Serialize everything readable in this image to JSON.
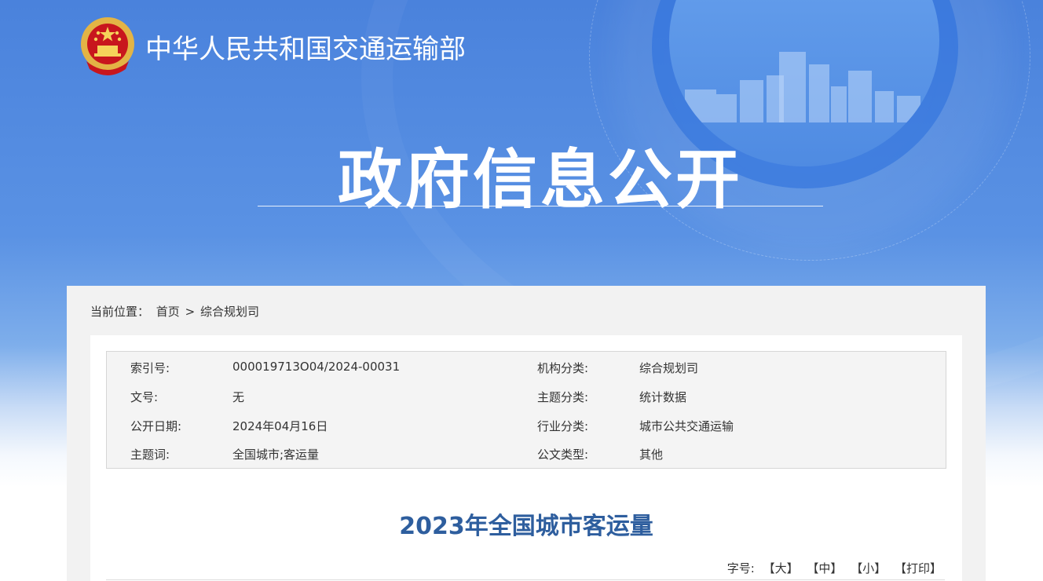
{
  "header": {
    "site_title": "中华人民共和国交通运输部",
    "hero_title": "政府信息公开"
  },
  "breadcrumb": {
    "label": "当前位置：",
    "home": "首页",
    "separator": ">",
    "current": "综合规划司"
  },
  "meta": {
    "index_label": "索引号:",
    "index_value": "000019713O04/2024-00031",
    "agency_label": "机构分类:",
    "agency_value": "综合规划司",
    "doc_no_label": "文号:",
    "doc_no_value": "无",
    "topic_label": "主题分类:",
    "topic_value": "统计数据",
    "date_label": "公开日期:",
    "date_value": "2024年04月16日",
    "industry_label": "行业分类:",
    "industry_value": "城市公共交通运输",
    "keywords_label": "主题词:",
    "keywords_value": "全国城市;客运量",
    "type_label": "公文类型:",
    "type_value": "其他"
  },
  "article": {
    "title": "2023年全国城市客运量"
  },
  "font_size": {
    "label": "字号:",
    "large": "【大】",
    "medium": "【中】",
    "small": "【小】",
    "print": "【打印】"
  },
  "colors": {
    "banner_blue": "#4a82dc",
    "title_blue": "#2e5e9e",
    "panel_gray": "#f2f2f2"
  },
  "icons": {
    "emblem": "national-emblem-icon"
  }
}
